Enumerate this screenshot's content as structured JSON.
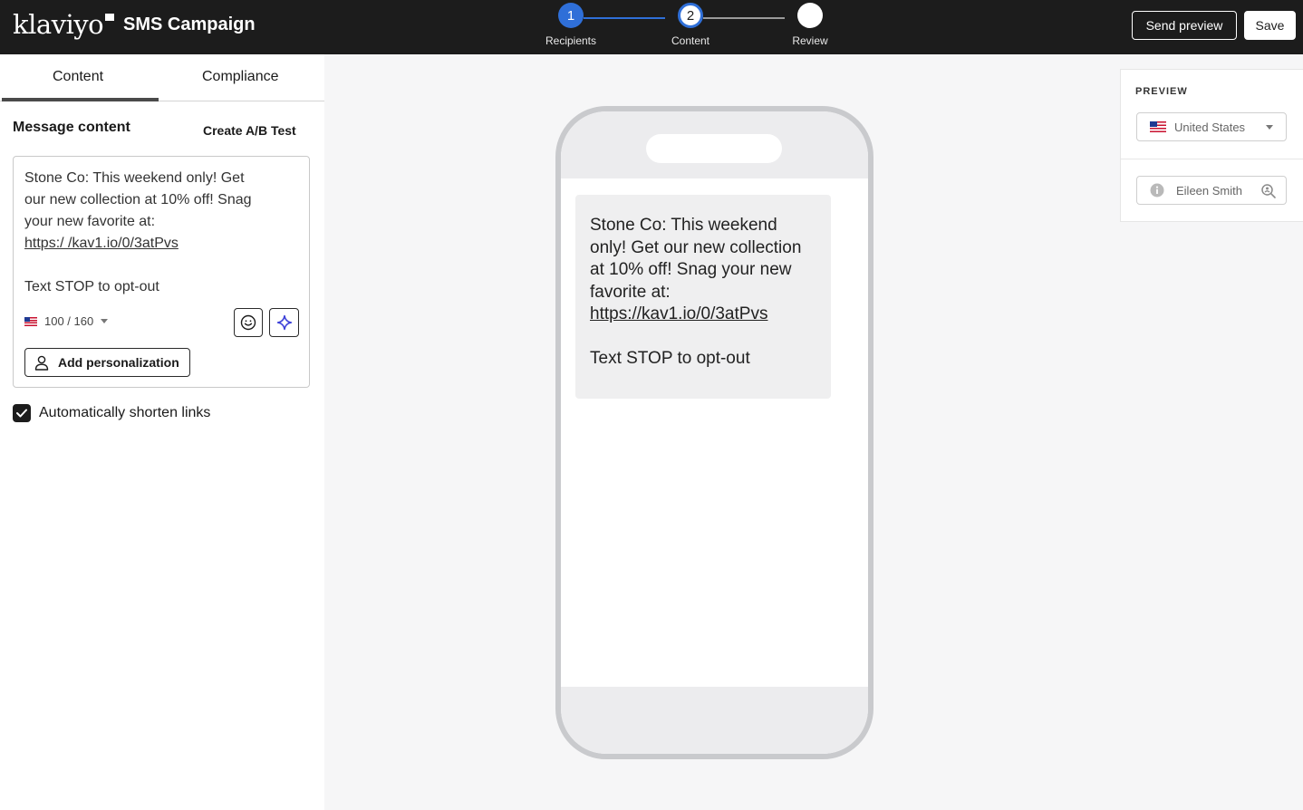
{
  "header": {
    "logo": "klaviyo",
    "title": "SMS Campaign",
    "steps": [
      {
        "number": "1",
        "label": "Recipients"
      },
      {
        "number": "2",
        "label": "Content"
      },
      {
        "number": "",
        "label": "Review"
      }
    ],
    "send_preview": "Send preview",
    "save": "Save"
  },
  "left": {
    "tabs": [
      "Content",
      "Compliance"
    ],
    "active_tab": "Content",
    "heading": "Message content",
    "ab_test": "Create A/B Test",
    "message_lines": [
      "Stone Co: This weekend only! Get",
      "our new collection at 10% off! Snag",
      "your new favorite at:",
      "https:/ /kav1.io/0/3atPvs",
      "",
      "Text STOP to opt-out"
    ],
    "char_count": "100 / 160",
    "add_personalization": "Add personalization",
    "shorten_links": "Automatically shorten links",
    "shorten_checked": true
  },
  "phone": {
    "line1": "Stone Co: This weekend",
    "line2": "only! Get our new collection",
    "line3": "at 10% off! Snag your new",
    "line4": "favorite at:",
    "url": "https://kav1.io/0/3atPvs",
    "optout": "Text STOP to opt-out"
  },
  "preview": {
    "heading": "PREVIEW",
    "country": "United States",
    "profile": "Eileen Smith"
  },
  "icons": {
    "emoji": "smiley-icon",
    "ai": "sparkle-icon",
    "person": "person-icon",
    "check": "check-icon",
    "info": "info-icon",
    "search": "zoom-search-icon"
  },
  "colors": {
    "topbar": "#1c1c1c",
    "step_active": "#2f6fd8",
    "ai_accent": "#3b3fd8"
  }
}
